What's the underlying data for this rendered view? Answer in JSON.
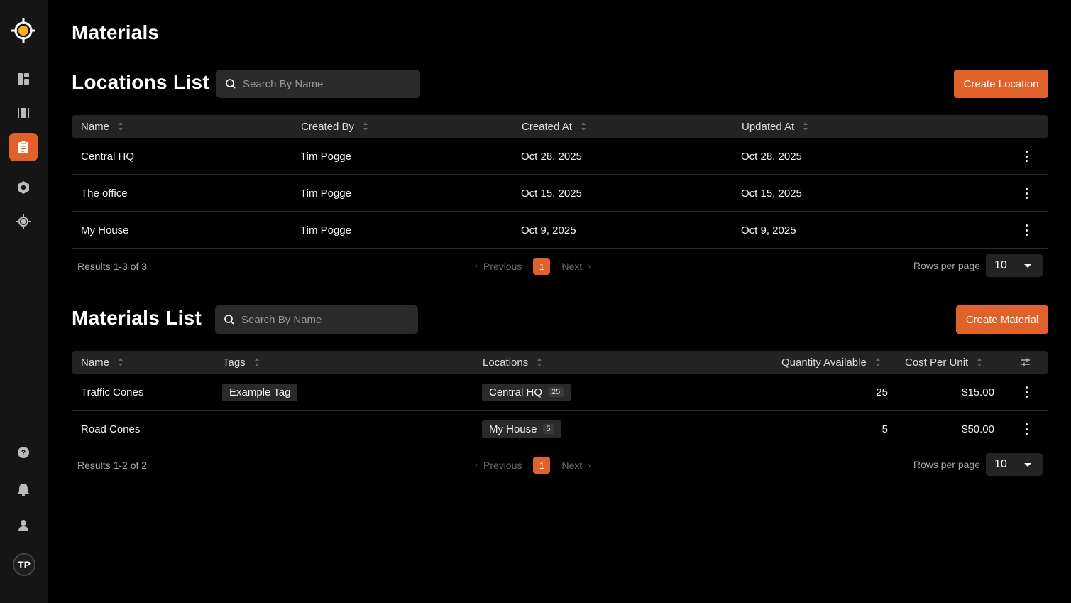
{
  "page": {
    "title": "Materials"
  },
  "sidebar": {
    "items": [
      {
        "icon": "dashboard-icon"
      },
      {
        "icon": "board-icon"
      },
      {
        "icon": "clipboard-icon",
        "active": true
      },
      {
        "icon": "settings-icon"
      },
      {
        "icon": "target-icon"
      }
    ],
    "bottom": [
      {
        "icon": "help-icon"
      },
      {
        "icon": "bell-icon"
      },
      {
        "icon": "user-icon"
      }
    ],
    "avatar_initials": "TP"
  },
  "locations": {
    "title": "Locations List",
    "search_placeholder": "Search By Name",
    "create_label": "Create Location",
    "columns": [
      "Name",
      "Created By",
      "Created At",
      "Updated At"
    ],
    "rows": [
      {
        "name": "Central HQ",
        "created_by": "Tim Pogge",
        "created_at": "Oct 28, 2025",
        "updated_at": "Oct 28, 2025"
      },
      {
        "name": "The office",
        "created_by": "Tim Pogge",
        "created_at": "Oct 15, 2025",
        "updated_at": "Oct 15, 2025"
      },
      {
        "name": "My House",
        "created_by": "Tim Pogge",
        "created_at": "Oct 9, 2025",
        "updated_at": "Oct 9, 2025"
      }
    ],
    "results": "Results 1-3 of 3",
    "previous": "Previous",
    "next": "Next",
    "page": "1",
    "rows_per_page_label": "Rows per page",
    "rows_per_page": "10"
  },
  "materials": {
    "title": "Materials List",
    "search_placeholder": "Search By Name",
    "create_label": "Create Material",
    "columns": [
      "Name",
      "Tags",
      "Locations",
      "Quantity Available",
      "Cost Per Unit"
    ],
    "rows": [
      {
        "name": "Traffic Cones",
        "tag": "Example Tag",
        "location": "Central HQ",
        "location_count": "25",
        "quantity": "25",
        "cost": "$15.00"
      },
      {
        "name": "Road Cones",
        "tag": "",
        "location": "My House",
        "location_count": "5",
        "quantity": "5",
        "cost": "$50.00"
      }
    ],
    "results": "Results 1-2 of 2",
    "previous": "Previous",
    "next": "Next",
    "page": "1",
    "rows_per_page_label": "Rows per page",
    "rows_per_page": "10"
  },
  "colors": {
    "accent": "#e0622a",
    "background": "#000000",
    "sidebar": "#151515"
  }
}
